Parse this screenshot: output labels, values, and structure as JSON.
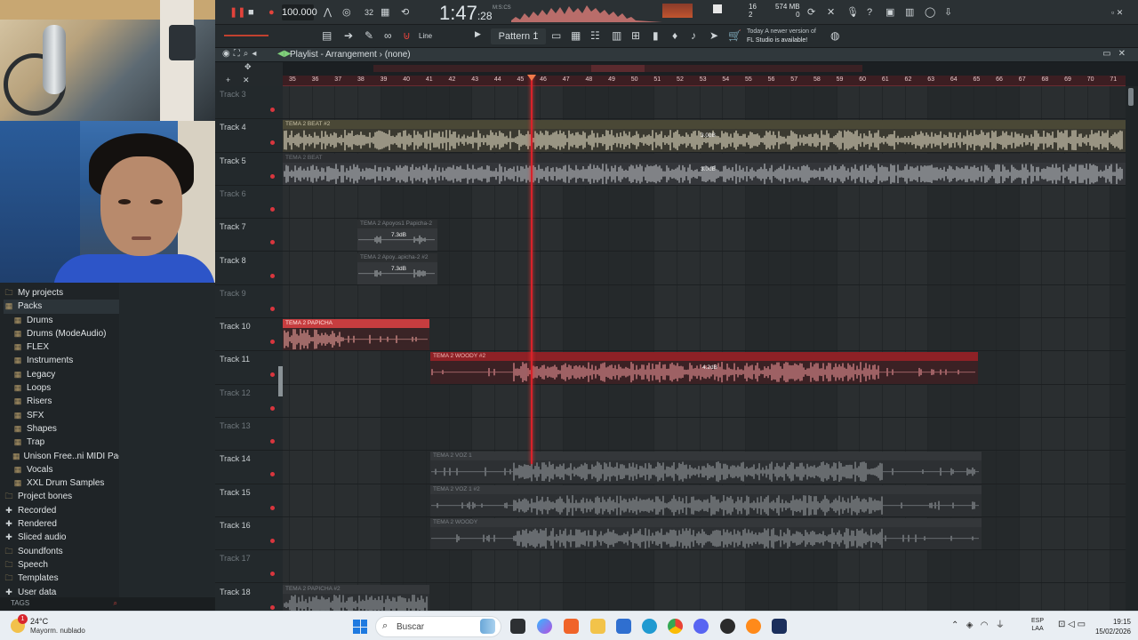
{
  "toolbar": {
    "tempo": "100.000",
    "time": "1:47",
    "time_fine": ":28",
    "time_unit": "M:S:CS",
    "cpu": "16",
    "cpu_sub": "2",
    "ram": "574 MB",
    "ram_sub": "0",
    "accent": "#e2433b"
  },
  "toolbar2": {
    "snap": "Line",
    "pattern": "Pattern 1",
    "hint_line1": "Today  A newer version of",
    "hint_line2": "FL Studio is available!"
  },
  "playlist": {
    "title": "Playlist - Arrangement",
    "sep": "›",
    "arrangement": "(none)"
  },
  "ruler": {
    "labels": [
      "35",
      "36",
      "37",
      "38",
      "39",
      "40",
      "41",
      "42",
      "43",
      "44",
      "45",
      "46",
      "47",
      "48",
      "49",
      "50",
      "51",
      "52",
      "53",
      "54",
      "55",
      "56",
      "57",
      "58",
      "59",
      "60",
      "61",
      "62",
      "63",
      "64",
      "65",
      "66",
      "67",
      "68",
      "69",
      "70",
      "71"
    ]
  },
  "tracks": [
    {
      "name": "Track 3"
    },
    {
      "name": "Track 4"
    },
    {
      "name": "Track 5"
    },
    {
      "name": "Track 6"
    },
    {
      "name": "Track 7"
    },
    {
      "name": "Track 8"
    },
    {
      "name": "Track 9"
    },
    {
      "name": "Track 10"
    },
    {
      "name": "Track 11"
    },
    {
      "name": "Track 12"
    },
    {
      "name": "Track 13"
    },
    {
      "name": "Track 14"
    },
    {
      "name": "Track 15"
    },
    {
      "name": "Track 16"
    },
    {
      "name": "Track 17"
    },
    {
      "name": "Track 18"
    }
  ],
  "clips": [
    {
      "name": "TEMA 2 BEAT #2",
      "db": "3.0dB"
    },
    {
      "name": "TEMA 2 BEAT",
      "db": "3.0dB"
    },
    {
      "name": "TEMA 2 Apoyos1 Papicha-2",
      "db": "7.3dB"
    },
    {
      "name": "TEMA 2 Apoy..apicha-2 #2",
      "db": "7.3dB"
    },
    {
      "name": "TEMA 2 PAPICHA"
    },
    {
      "name": "TEMA 2 WOODY #2",
      "db": "4.2dB"
    },
    {
      "name": "TEMA 2 VOZ 1"
    },
    {
      "name": "TEMA 2 VOZ 1 #2"
    },
    {
      "name": "TEMA 2 WOODY"
    },
    {
      "name": "TEMA 2 PAPICHA #2"
    }
  ],
  "browser": {
    "items": [
      {
        "label": "My projects",
        "icon": "folder-icon",
        "sub": false
      },
      {
        "label": "Packs",
        "icon": "pack-folder-icon",
        "sub": false
      },
      {
        "label": "Drums",
        "icon": "pack-folder-icon",
        "sub": true
      },
      {
        "label": "Drums (ModeAudio)",
        "icon": "pack-folder-icon",
        "sub": true
      },
      {
        "label": "FLEX",
        "icon": "pack-folder-icon",
        "sub": true
      },
      {
        "label": "Instruments",
        "icon": "pack-folder-icon",
        "sub": true
      },
      {
        "label": "Legacy",
        "icon": "pack-folder-icon",
        "sub": true
      },
      {
        "label": "Loops",
        "icon": "pack-folder-icon",
        "sub": true
      },
      {
        "label": "Risers",
        "icon": "pack-folder-icon",
        "sub": true
      },
      {
        "label": "SFX",
        "icon": "pack-folder-icon",
        "sub": true
      },
      {
        "label": "Shapes",
        "icon": "pack-folder-icon",
        "sub": true
      },
      {
        "label": "Trap",
        "icon": "pack-folder-icon",
        "sub": true
      },
      {
        "label": "Unison Free..ni MIDI Pack",
        "icon": "pack-folder-icon",
        "sub": true
      },
      {
        "label": "Vocals",
        "icon": "pack-folder-icon",
        "sub": true
      },
      {
        "label": "XXL Drum Samples",
        "icon": "pack-folder-icon",
        "sub": true
      },
      {
        "label": "Project bones",
        "icon": "folder-icon",
        "sub": false
      },
      {
        "label": "Recorded",
        "icon": "plus-folder-icon",
        "sub": false
      },
      {
        "label": "Rendered",
        "icon": "plus-folder-icon",
        "sub": false
      },
      {
        "label": "Sliced audio",
        "icon": "plus-folder-icon",
        "sub": false
      },
      {
        "label": "Soundfonts",
        "icon": "folder-icon",
        "sub": false
      },
      {
        "label": "Speech",
        "icon": "folder-icon",
        "sub": false
      },
      {
        "label": "Templates",
        "icon": "folder-icon",
        "sub": false
      },
      {
        "label": "User data",
        "icon": "plus-folder-icon",
        "sub": false
      }
    ],
    "tags": "TAGS"
  },
  "taskbar": {
    "temp": "24°C",
    "condition": "Mayorm. nublado",
    "search_placeholder": "Buscar",
    "lang1": "ESP",
    "lang2": "LAA",
    "time": "19:15",
    "date": "15/02/2026",
    "notification_count": "1"
  }
}
